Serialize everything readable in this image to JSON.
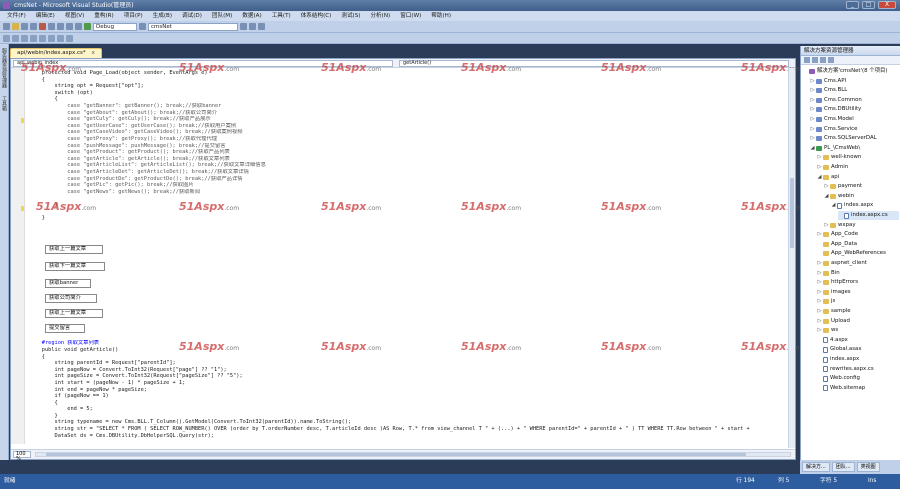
{
  "window": {
    "title": "cmsNet - Microsoft Visual Studio(管理员)",
    "buttons": {
      "min": "_",
      "max": "□",
      "close": "X"
    }
  },
  "menu": [
    "文件(F)",
    "编辑(E)",
    "视图(V)",
    "重构(R)",
    "项目(P)",
    "生成(B)",
    "调试(D)",
    "团队(M)",
    "数据(A)",
    "工具(T)",
    "体系结构(C)",
    "测试(S)",
    "分析(N)",
    "窗口(W)",
    "帮助(H)"
  ],
  "toolbar": {
    "config": "Debug",
    "search": "cmsNet"
  },
  "left_tabs": [
    "服务器资源管理器",
    "工具箱"
  ],
  "doc_tab": {
    "label": "api/webin/index.aspx.cs*",
    "close": "x"
  },
  "nav": {
    "left": "api_webin_index",
    "right": "getArticle()"
  },
  "code_lines": [
    {
      "t": "    protected void Page_Load(object sender, EventArgs e)",
      "k": "plain"
    },
    {
      "t": "    {",
      "k": "plain"
    },
    {
      "t": "        string opt = Request[\"opt\"];",
      "k": "plain"
    },
    {
      "t": "        switch (opt)",
      "k": "plain"
    },
    {
      "t": "        {",
      "k": "plain"
    },
    {
      "t": "            case \"getBanner\": getBanner(); break;//获取banner",
      "k": "case"
    },
    {
      "t": "            case \"getAbout\": getAbout(); break;//获取公司简介",
      "k": "case"
    },
    {
      "t": "            case \"getCuly\": getCuly(); break;//获取产品展示",
      "k": "case"
    },
    {
      "t": "            case \"getUserCase\": getUserCase(); break;//获取用户案例",
      "k": "case"
    },
    {
      "t": "            case \"getCaseVideo\": getCaseVideo(); break;//获取案例视频",
      "k": "case"
    },
    {
      "t": "            case \"getProxy\": getProxy(); break;//获取代理代理",
      "k": "case"
    },
    {
      "t": "            case \"pushMessage\": pushMessage(); break;//提交留言",
      "k": "case"
    },
    {
      "t": "            case \"getProduct\": getProduct(); break;//获取产品列表",
      "k": "case"
    },
    {
      "t": "            case \"getArticle\": getArticle(); break;//获取文章列表",
      "k": "case"
    },
    {
      "t": "            case \"getArticleList\": getArticleList(); break;//获取文章详细信息",
      "k": "case"
    },
    {
      "t": "            case \"getArticleDet\": getArticleDet(); break;//获取文章详情",
      "k": "case"
    },
    {
      "t": "            case \"getProductDe\": getProductDe(); break;//获取产品详情",
      "k": "case"
    },
    {
      "t": "            case \"getPic\": getPic(); break;//获取图片",
      "k": "case"
    },
    {
      "t": "            case \"getNews\": getNews(); break;//获取新闻",
      "k": "case"
    },
    {
      "t": "",
      "k": "plain"
    },
    {
      "t": "        }",
      "k": "plain"
    },
    {
      "t": "",
      "k": "plain"
    },
    {
      "t": "    }",
      "k": "plain"
    }
  ],
  "ui_boxes": [
    "获取上一篇文章",
    "获取下一篇文章",
    "获取banner",
    "获取公司简介",
    "获取上一篇文章",
    "提交留言"
  ],
  "code_lines2": [
    {
      "t": "    #region 获取文章列表",
      "k": "region"
    },
    {
      "t": "    public void getArticle()",
      "k": "decl"
    },
    {
      "t": "    {",
      "k": "plain"
    },
    {
      "t": "        string parentId = Request[\"parentId\"];",
      "k": "plain"
    },
    {
      "t": "        int pageNow = Convert.ToInt32(Request[\"page\"] ?? \"1\");",
      "k": "plain"
    },
    {
      "t": "        int pageSize = Convert.ToInt32(Request[\"pageSize\"] ?? \"5\");",
      "k": "plain"
    },
    {
      "t": "        int start = (pageNow - 1) * pageSize + 1;",
      "k": "plain"
    },
    {
      "t": "        int end = pageNow * pageSize;",
      "k": "plain"
    },
    {
      "t": "        if (pageNow == 1)",
      "k": "plain"
    },
    {
      "t": "        {",
      "k": "plain"
    },
    {
      "t": "            end = 5;",
      "k": "plain"
    },
    {
      "t": "        }",
      "k": "plain"
    },
    {
      "t": "        string typename = new Cms.BLL.T_Column().GetModel(Convert.ToInt32(parentId)).name.ToString();",
      "k": "plain"
    },
    {
      "t": "        string str = \"SELECT * FROM ( SELECT ROW_NUMBER() OVER (order by T.orderNumber desc, T.articleId desc )AS Row, T.* from view_channel T \" + (...) + \" WHERE parentId=\" + parentId + \" ) TT WHERE TT.Row between \" + start +",
      "k": "plain"
    },
    {
      "t": "        DataSet ds = Cms.DBUtility.DbHelperSQL.Query(str);",
      "k": "plain"
    }
  ],
  "watermark": {
    "brand": "51Aspx",
    "suffix": ".com"
  },
  "zoom": "100 %",
  "solution": {
    "title": "解决方案资源管理器",
    "nodes": [
      {
        "label": "解决方案'cmsNet'(8 个项目)",
        "d": 0,
        "icon": "sln",
        "arrow": ""
      },
      {
        "label": "Cms.API",
        "d": 1,
        "icon": "proj",
        "arrow": "▷"
      },
      {
        "label": "Cms.BLL",
        "d": 1,
        "icon": "proj",
        "arrow": "▷"
      },
      {
        "label": "Cms.Common",
        "d": 1,
        "icon": "proj",
        "arrow": "▷"
      },
      {
        "label": "Cms.DBUtility",
        "d": 1,
        "icon": "proj",
        "arrow": "▷"
      },
      {
        "label": "Cms.Model",
        "d": 1,
        "icon": "proj",
        "arrow": "▷"
      },
      {
        "label": "Cms.Service",
        "d": 1,
        "icon": "proj",
        "arrow": "▷"
      },
      {
        "label": "Cms.SQLServerDAL",
        "d": 1,
        "icon": "proj",
        "arrow": "▷"
      },
      {
        "label": "PL_\\CmsWeb\\",
        "d": 1,
        "icon": "web",
        "arrow": "◢"
      },
      {
        "label": "well-known",
        "d": 2,
        "icon": "fold",
        "arrow": "▷"
      },
      {
        "label": "Admin",
        "d": 2,
        "icon": "fold",
        "arrow": "▷"
      },
      {
        "label": "api",
        "d": 2,
        "icon": "fold",
        "arrow": "◢"
      },
      {
        "label": "payment",
        "d": 3,
        "icon": "fold",
        "arrow": "▷"
      },
      {
        "label": "webin",
        "d": 3,
        "icon": "fold",
        "arrow": "◢"
      },
      {
        "label": "index.aspx",
        "d": 4,
        "icon": "file",
        "arrow": "◢"
      },
      {
        "label": "index.aspx.cs",
        "d": 5,
        "icon": "file",
        "arrow": "",
        "sel": true
      },
      {
        "label": "wxpay",
        "d": 3,
        "icon": "fold",
        "arrow": "▷"
      },
      {
        "label": "App_Code",
        "d": 2,
        "icon": "fold",
        "arrow": "▷"
      },
      {
        "label": "App_Data",
        "d": 2,
        "icon": "fold",
        "arrow": ""
      },
      {
        "label": "App_WebReferences",
        "d": 2,
        "icon": "fold",
        "arrow": ""
      },
      {
        "label": "aspnet_client",
        "d": 2,
        "icon": "fold",
        "arrow": "▷"
      },
      {
        "label": "Bin",
        "d": 2,
        "icon": "fold",
        "arrow": "▷"
      },
      {
        "label": "httpErrors",
        "d": 2,
        "icon": "fold",
        "arrow": "▷"
      },
      {
        "label": "images",
        "d": 2,
        "icon": "fold",
        "arrow": "▷"
      },
      {
        "label": "js",
        "d": 2,
        "icon": "fold",
        "arrow": "▷"
      },
      {
        "label": "sample",
        "d": 2,
        "icon": "fold",
        "arrow": "▷"
      },
      {
        "label": "Upload",
        "d": 2,
        "icon": "fold",
        "arrow": "▷"
      },
      {
        "label": "ws",
        "d": 2,
        "icon": "fold",
        "arrow": "▷"
      },
      {
        "label": "4.aspx",
        "d": 2,
        "icon": "file",
        "arrow": ""
      },
      {
        "label": "Global.asax",
        "d": 2,
        "icon": "file",
        "arrow": ""
      },
      {
        "label": "index.aspx",
        "d": 2,
        "icon": "file",
        "arrow": ""
      },
      {
        "label": "rewrites.aspx.cs",
        "d": 2,
        "icon": "file",
        "arrow": ""
      },
      {
        "label": "Web.config",
        "d": 2,
        "icon": "file",
        "arrow": ""
      },
      {
        "label": "Web.sitemap",
        "d": 2,
        "icon": "file",
        "arrow": ""
      }
    ]
  },
  "sol_tabs": [
    "解决方...",
    "团队...",
    "类视图"
  ],
  "status": {
    "ready": "就绪",
    "line": "行 194",
    "col": "列 5",
    "ch": "字符 5",
    "mode": "Ins"
  }
}
